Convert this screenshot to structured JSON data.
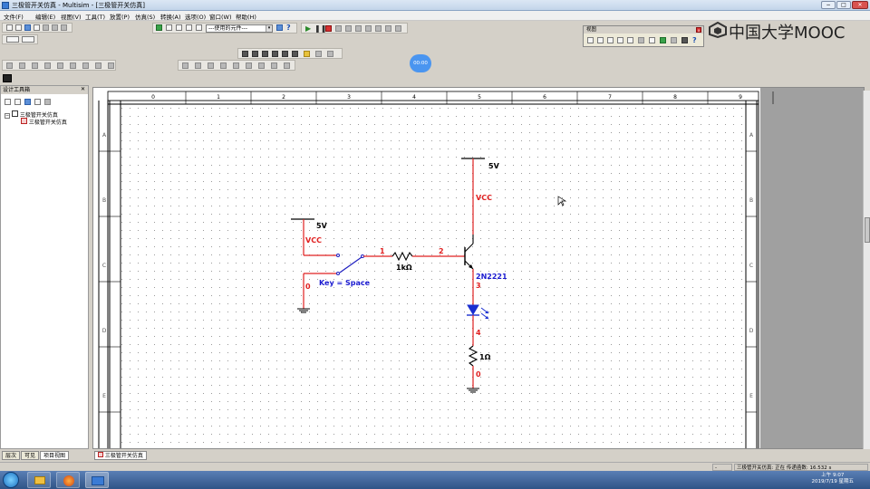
{
  "window": {
    "title": "三极管开关仿真 - Multisim - [三极管开关仿真]",
    "min": "−",
    "max": "□",
    "close": "✕"
  },
  "menu": [
    "文件(F)",
    "编辑(E)",
    "视图(V)",
    "工具(T)",
    "放置(P)",
    "仿真(S)",
    "转换(A)",
    "选项(O)",
    "窗口(W)",
    "帮助(H)"
  ],
  "toolbar": {
    "component_dropdown": "---使用的元件---"
  },
  "overview": {
    "title": "视图"
  },
  "mooc": {
    "logo": "中国大学MOOC"
  },
  "timer": "00:00",
  "design_panel": {
    "title": "设计工具箱",
    "close": "✕",
    "tree_root": "三极管开关仿真",
    "tree_child": "三极管开关仿真",
    "tabs": [
      "层次",
      "可见",
      "项目视图"
    ]
  },
  "ruler": {
    "columns": [
      "0",
      "1",
      "2",
      "3",
      "4",
      "5",
      "6",
      "7",
      "8",
      "9"
    ],
    "rows": [
      "A",
      "B",
      "C",
      "D",
      "E"
    ]
  },
  "schematic": {
    "vcc_top_voltage": "5V",
    "vcc_top_label": "VCC",
    "vcc_left_voltage": "5V",
    "vcc_left_label": "VCC",
    "resistor1": "1kΩ",
    "net1": "1",
    "net2": "2",
    "transistor": "2N2221",
    "net3": "3",
    "net4": "4",
    "resistor2": "1Ω",
    "net0_right": "0",
    "net0_left": "0",
    "switch_key": "Key = Space"
  },
  "sheet_tab": "三极管开关仿真",
  "status": {
    "left": "-",
    "right": "三极管开关仿真: 正在 传递函数: 16.532 s"
  },
  "taskbar": {
    "time": "上午 9:07",
    "date": "2019/7/19 星期五"
  },
  "colors": {
    "wire_red": "#e02020",
    "wire_blue": "#2020c0",
    "led_blue": "#1a2fd0",
    "label_blue": "#1a1ad0"
  }
}
